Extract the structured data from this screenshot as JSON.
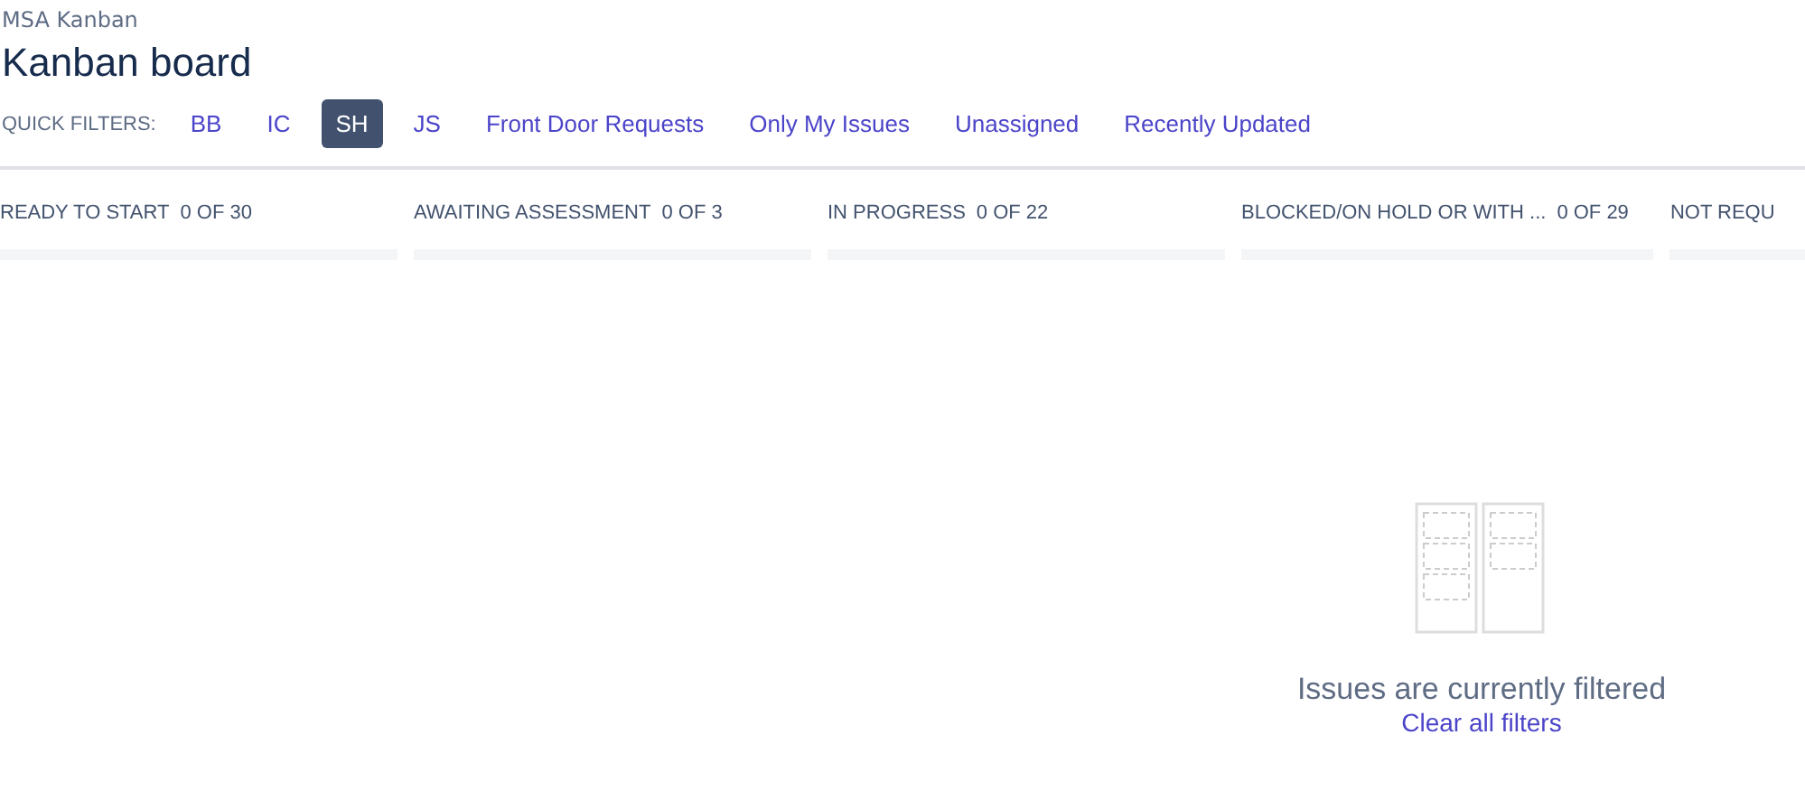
{
  "breadcrumb": "MSA Kanban",
  "title": "Kanban board",
  "quick_filters": {
    "label": "QUICK FILTERS:",
    "items": [
      {
        "label": "BB",
        "selected": false
      },
      {
        "label": "IC",
        "selected": false
      },
      {
        "label": "SH",
        "selected": true
      },
      {
        "label": "JS",
        "selected": false
      },
      {
        "label": "Front Door Requests",
        "selected": false
      },
      {
        "label": "Only My Issues",
        "selected": false
      },
      {
        "label": "Unassigned",
        "selected": false
      },
      {
        "label": "Recently Updated",
        "selected": false
      }
    ]
  },
  "columns": [
    {
      "name": "READY TO START",
      "count": "0 OF 30"
    },
    {
      "name": "AWAITING ASSESSMENT",
      "count": "0 OF 3"
    },
    {
      "name": "IN PROGRESS",
      "count": "0 OF 22"
    },
    {
      "name": "BLOCKED/ON HOLD OR WITH ...",
      "count": "0 OF 29"
    },
    {
      "name": "NOT REQU"
    }
  ],
  "empty_state": {
    "message": "Issues are currently filtered",
    "link": "Clear all filters"
  }
}
